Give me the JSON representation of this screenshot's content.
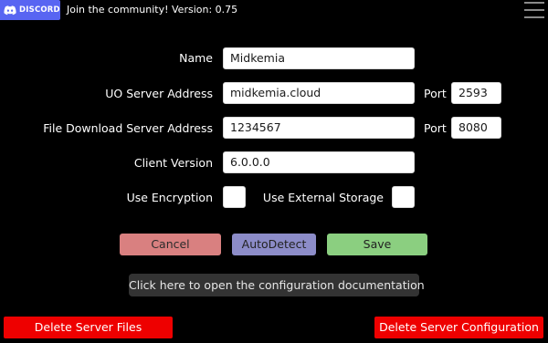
{
  "header": {
    "discord_label": "DISCORD",
    "community_text": "Join the community!",
    "version_text": "Version: 0.75",
    "brand_color": "#5865F2"
  },
  "form": {
    "name_label": "Name",
    "name_value": "Midkemia",
    "uo_server_label": "UO Server Address",
    "uo_server_value": "midkemia.cloud",
    "uo_port_label": "Port",
    "uo_port_value": "2593",
    "download_server_label": "File Download Server Address",
    "download_server_value": "1234567",
    "download_port_label": "Port",
    "download_port_value": "8080",
    "client_version_label": "Client Version",
    "client_version_value": "6.0.0.0",
    "encryption_label": "Use Encryption",
    "external_storage_label": "Use External Storage"
  },
  "buttons": {
    "cancel": "Cancel",
    "autodetect": "AutoDetect",
    "save": "Save",
    "docs": "Click here to open the configuration documentation",
    "delete_files": "Delete Server Files",
    "delete_config": "Delete Server Configuration"
  },
  "icons": {
    "discord": "discord-logo-icon",
    "menu": "hamburger-menu-icon"
  },
  "colors": {
    "cancel": "#D98080",
    "autodetect": "#8C8CC8",
    "save": "#8BCF80",
    "docs": "#333333",
    "danger": "#EE0000"
  }
}
